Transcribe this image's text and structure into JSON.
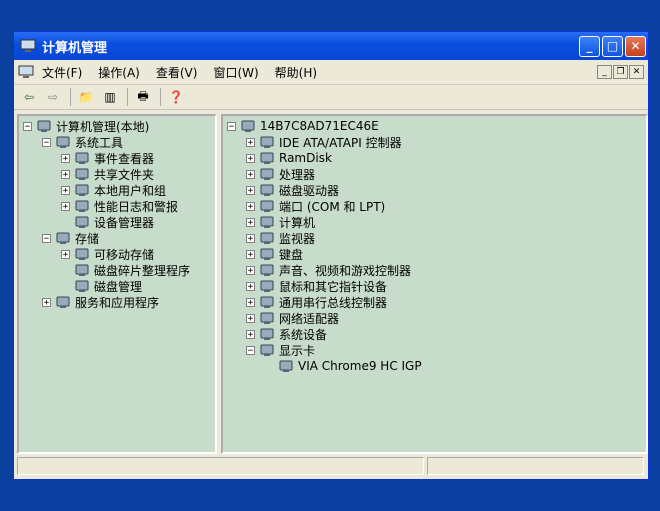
{
  "window": {
    "title": "计算机管理"
  },
  "menu": [
    "文件(F)",
    "操作(A)",
    "查看(V)",
    "窗口(W)",
    "帮助(H)"
  ],
  "left_tree": [
    {
      "label": "计算机管理(本地)",
      "indent": 0,
      "exp": "-",
      "icon": "computer-icon"
    },
    {
      "label": "系统工具",
      "indent": 1,
      "exp": "-",
      "icon": "tools-icon"
    },
    {
      "label": "事件查看器",
      "indent": 2,
      "exp": "+",
      "icon": "event-viewer-icon"
    },
    {
      "label": "共享文件夹",
      "indent": 2,
      "exp": "+",
      "icon": "shared-folder-icon"
    },
    {
      "label": "本地用户和组",
      "indent": 2,
      "exp": "+",
      "icon": "users-icon"
    },
    {
      "label": "性能日志和警报",
      "indent": 2,
      "exp": "+",
      "icon": "performance-icon"
    },
    {
      "label": "设备管理器",
      "indent": 2,
      "exp": "",
      "icon": "device-manager-icon"
    },
    {
      "label": "存储",
      "indent": 1,
      "exp": "-",
      "icon": "storage-icon"
    },
    {
      "label": "可移动存储",
      "indent": 2,
      "exp": "+",
      "icon": "removable-storage-icon"
    },
    {
      "label": "磁盘碎片整理程序",
      "indent": 2,
      "exp": "",
      "icon": "defrag-icon"
    },
    {
      "label": "磁盘管理",
      "indent": 2,
      "exp": "",
      "icon": "disk-management-icon"
    },
    {
      "label": "服务和应用程序",
      "indent": 1,
      "exp": "+",
      "icon": "services-icon"
    }
  ],
  "right_tree": [
    {
      "label": "14B7C8AD71EC46E",
      "indent": 0,
      "exp": "-",
      "icon": "computer-icon"
    },
    {
      "label": "IDE ATA/ATAPI 控制器",
      "indent": 1,
      "exp": "+",
      "icon": "ide-controller-icon"
    },
    {
      "label": "RamDisk",
      "indent": 1,
      "exp": "+",
      "icon": "ramdisk-icon"
    },
    {
      "label": "处理器",
      "indent": 1,
      "exp": "+",
      "icon": "processor-icon"
    },
    {
      "label": "磁盘驱动器",
      "indent": 1,
      "exp": "+",
      "icon": "disk-drive-icon"
    },
    {
      "label": "端口 (COM 和 LPT)",
      "indent": 1,
      "exp": "+",
      "icon": "port-icon"
    },
    {
      "label": "计算机",
      "indent": 1,
      "exp": "+",
      "icon": "computer-node-icon"
    },
    {
      "label": "监视器",
      "indent": 1,
      "exp": "+",
      "icon": "monitor-icon"
    },
    {
      "label": "键盘",
      "indent": 1,
      "exp": "+",
      "icon": "keyboard-icon"
    },
    {
      "label": "声音、视频和游戏控制器",
      "indent": 1,
      "exp": "+",
      "icon": "sound-icon"
    },
    {
      "label": "鼠标和其它指针设备",
      "indent": 1,
      "exp": "+",
      "icon": "mouse-icon"
    },
    {
      "label": "通用串行总线控制器",
      "indent": 1,
      "exp": "+",
      "icon": "usb-icon"
    },
    {
      "label": "网络适配器",
      "indent": 1,
      "exp": "+",
      "icon": "network-adapter-icon"
    },
    {
      "label": "系统设备",
      "indent": 1,
      "exp": "+",
      "icon": "system-device-icon"
    },
    {
      "label": "显示卡",
      "indent": 1,
      "exp": "-",
      "icon": "display-adapter-icon"
    },
    {
      "label": "VIA Chrome9 HC IGP",
      "indent": 2,
      "exp": "",
      "icon": "display-device-icon"
    }
  ],
  "colors": {
    "desktop": "#0b3fa0",
    "pane": "#c8dccb",
    "titlebar": "#0a4fe0"
  }
}
